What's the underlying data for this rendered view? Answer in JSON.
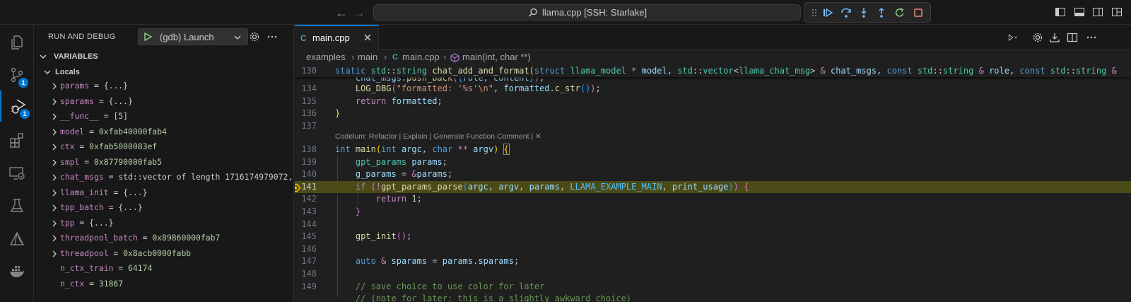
{
  "titlebar": {
    "command_center": "llama.cpp [SSH: Starlake]"
  },
  "activity_bar": {
    "items": [
      {
        "name": "explorer",
        "badge": ""
      },
      {
        "name": "source-control",
        "badge": "1"
      },
      {
        "name": "run-and-debug",
        "badge": "1"
      },
      {
        "name": "extensions",
        "badge": ""
      },
      {
        "name": "remote-explorer",
        "badge": ""
      },
      {
        "name": "testing",
        "badge": ""
      },
      {
        "name": "copilot",
        "badge": ""
      },
      {
        "name": "docker",
        "badge": ""
      }
    ]
  },
  "sidebar": {
    "title": "RUN AND DEBUG",
    "launch_config": "(gdb) Launch",
    "variables_header": "VARIABLES",
    "locals_header": "Locals",
    "variables": [
      {
        "name": "params",
        "value": "{...}",
        "expandable": true
      },
      {
        "name": "sparams",
        "value": "{...}",
        "expandable": true
      },
      {
        "name": "__func__",
        "value": "[5]",
        "expandable": true
      },
      {
        "name": "model",
        "value": "0xfab40000fab4",
        "expandable": true
      },
      {
        "name": "ctx",
        "value": "0xfab5000083ef",
        "expandable": true
      },
      {
        "name": "smpl",
        "value": "0x87790000fab5",
        "expandable": true
      },
      {
        "name": "chat_msgs",
        "value": "std::vector of length 1716174979072, …",
        "expandable": true
      },
      {
        "name": "llama_init",
        "value": "{...}",
        "expandable": true
      },
      {
        "name": "tpp_batch",
        "value": "{...}",
        "expandable": true
      },
      {
        "name": "tpp",
        "value": "{...}",
        "expandable": true
      },
      {
        "name": "threadpool_batch",
        "value": "0x89860000fab7",
        "expandable": true
      },
      {
        "name": "threadpool",
        "value": "0x8acb0000fabb",
        "expandable": true
      },
      {
        "name": "n_ctx_train",
        "value": "64174",
        "expandable": false
      },
      {
        "name": "n_ctx",
        "value": "31867",
        "expandable": false
      }
    ]
  },
  "editor": {
    "tab": {
      "label": "main.cpp"
    },
    "breadcrumb": [
      "examples",
      "main",
      "main.cpp",
      "main(int, char **)"
    ],
    "codelens": "Codelum: Refactor | Explain | Generate Function Comment | ✕",
    "current_line": "141",
    "line_numbers": {
      "sticky": "130",
      "l134": "134",
      "l135": "135",
      "l136": "136",
      "l137": "137",
      "l138": "138",
      "l139": "139",
      "l140": "140",
      "l141": "141",
      "l142": "142",
      "l143": "143",
      "l144": "144",
      "l145": "145",
      "l146": "146",
      "l147": "147",
      "l148": "148",
      "l149": "149"
    }
  }
}
